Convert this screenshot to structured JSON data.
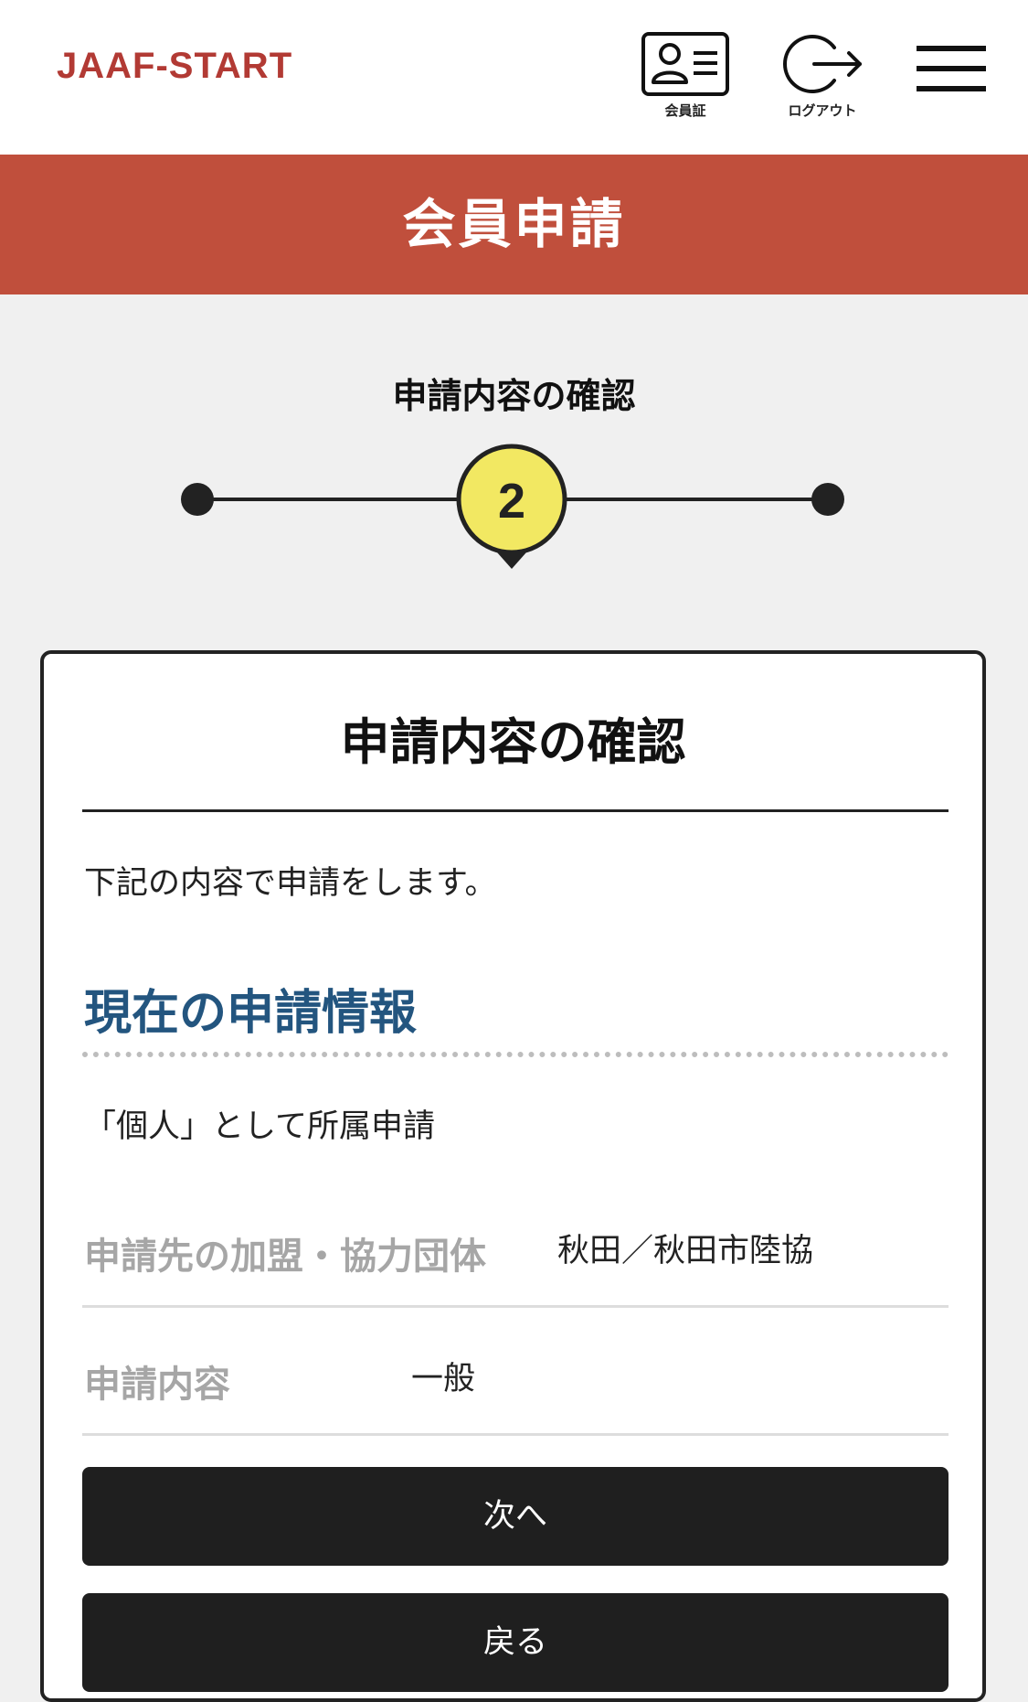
{
  "header": {
    "logo": "JAAF-START",
    "member_card_label": "会員証",
    "logout_label": "ログアウト"
  },
  "page_title": "会員申請",
  "step": {
    "title": "申請内容の確認",
    "current_number": "2",
    "current_color": "#f2e862"
  },
  "card": {
    "title": "申請内容の確認",
    "intro": "下記の内容で申請をします。",
    "section_heading": "現在の申請情報",
    "affiliation_text": "「個人」として所属申請",
    "rows": [
      {
        "label": "申請先の加盟・協力団体",
        "value": "秋田／秋田市陸協"
      },
      {
        "label": "申請内容",
        "value": "一般"
      }
    ],
    "next_button": "次へ",
    "back_button": "戻る"
  },
  "colors": {
    "brand_red": "#c04f3c",
    "logo_red": "#b23a34",
    "section_blue": "#23557f",
    "button_dark": "#1f1f1f"
  }
}
